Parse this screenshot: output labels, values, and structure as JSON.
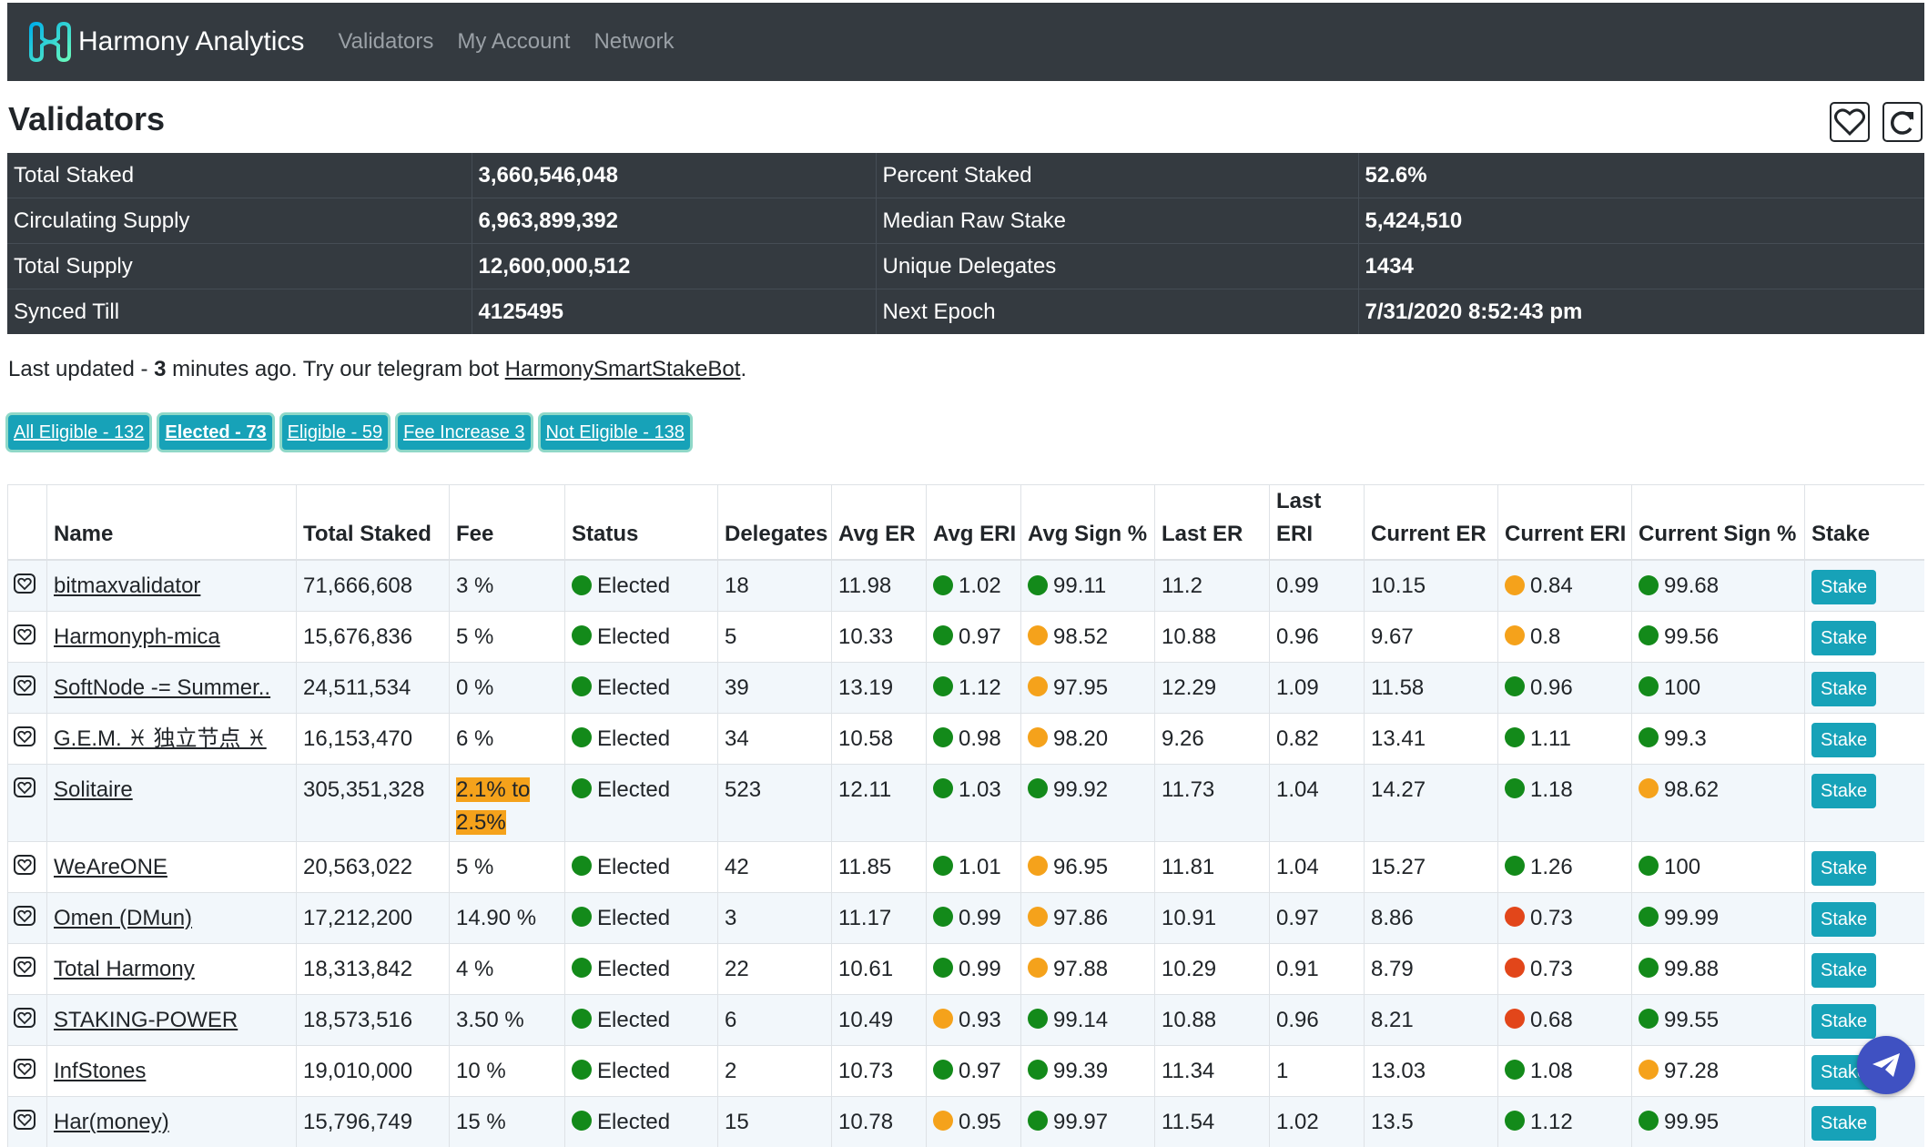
{
  "nav": {
    "brand": "Harmony Analytics",
    "links": [
      "Validators",
      "My Account",
      "Network"
    ]
  },
  "page": {
    "title": "Validators",
    "favorite_icon": "heart-icon",
    "refresh_icon": "refresh-icon"
  },
  "stats": [
    [
      "Total Staked",
      "3,660,546,048",
      "Percent Staked",
      "52.6%"
    ],
    [
      "Circulating Supply",
      "6,963,899,392",
      "Median Raw Stake",
      "5,424,510"
    ],
    [
      "Total Supply",
      "12,600,000,512",
      "Unique Delegates",
      "1434"
    ],
    [
      "Synced Till",
      "4125495",
      "Next Epoch",
      "7/31/2020 8:52:43 pm"
    ]
  ],
  "updated": {
    "prefix": "Last updated - ",
    "minutes": "3",
    "middle": " minutes ago. Try our telegram bot ",
    "bot_link": "HarmonySmartStakeBot",
    "suffix": "."
  },
  "filters": [
    {
      "label": "All Eligible - 132",
      "active": false
    },
    {
      "label": "Elected - 73",
      "active": true
    },
    {
      "label": "Eligible - 59",
      "active": false
    },
    {
      "label": "Fee Increase 3",
      "active": false
    },
    {
      "label": "Not Eligible - 138",
      "active": false
    }
  ],
  "columns": [
    "",
    "Name",
    "Total Staked",
    "Fee",
    "Status",
    "Delegates",
    "Avg ER",
    "Avg ERI",
    "Avg Sign %",
    "Last ER",
    "Last ERI",
    "Current ER",
    "Current ERI",
    "Current Sign %",
    "Stake"
  ],
  "colors": {
    "green": "#138a1a",
    "orange": "#f5a21b",
    "red": "#e2461a",
    "accent": "#17a2b8",
    "navbar": "#343a40"
  },
  "rows": [
    {
      "name": "bitmaxvalidator",
      "staked": "71,666,608",
      "fee": "3 %",
      "status": "Elected",
      "delegates": "18",
      "avg_er": "11.98",
      "avg_eri": [
        "green",
        "1.02"
      ],
      "avg_sign": [
        "green",
        "99.11"
      ],
      "last_er": "11.2",
      "last_eri": "0.99",
      "cur_er": "10.15",
      "cur_eri": [
        "orange",
        "0.84"
      ],
      "cur_sign": [
        "green",
        "99.68"
      ],
      "stake": "Stake"
    },
    {
      "name": "Harmonyph-mica",
      "staked": "15,676,836",
      "fee": "5 %",
      "status": "Elected",
      "delegates": "5",
      "avg_er": "10.33",
      "avg_eri": [
        "green",
        "0.97"
      ],
      "avg_sign": [
        "orange",
        "98.52"
      ],
      "last_er": "10.88",
      "last_eri": "0.96",
      "cur_er": "9.67",
      "cur_eri": [
        "orange",
        "0.8"
      ],
      "cur_sign": [
        "green",
        "99.56"
      ],
      "stake": "Stake"
    },
    {
      "name": "SoftNode -= Summer..",
      "staked": "24,511,534",
      "fee": "0 %",
      "status": "Elected",
      "delegates": "39",
      "avg_er": "13.19",
      "avg_eri": [
        "green",
        "1.12"
      ],
      "avg_sign": [
        "orange",
        "97.95"
      ],
      "last_er": "12.29",
      "last_eri": "1.09",
      "cur_er": "11.58",
      "cur_eri": [
        "green",
        "0.96"
      ],
      "cur_sign": [
        "green",
        "100"
      ],
      "stake": "Stake"
    },
    {
      "name": "G.E.M. ♓ 独立节点 ♓",
      "staked": "16,153,470",
      "fee": "6 %",
      "status": "Elected",
      "delegates": "34",
      "avg_er": "10.58",
      "avg_eri": [
        "green",
        "0.98"
      ],
      "avg_sign": [
        "orange",
        "98.20"
      ],
      "last_er": "9.26",
      "last_eri": "0.82",
      "cur_er": "13.41",
      "cur_eri": [
        "green",
        "1.11"
      ],
      "cur_sign": [
        "green",
        "99.3"
      ],
      "stake": "Stake"
    },
    {
      "name": "Solitaire",
      "staked": "305,351,328",
      "fee": "2.1% to 2.5%",
      "fee_highlight": true,
      "status": "Elected",
      "delegates": "523",
      "avg_er": "12.11",
      "avg_eri": [
        "green",
        "1.03"
      ],
      "avg_sign": [
        "green",
        "99.92"
      ],
      "last_er": "11.73",
      "last_eri": "1.04",
      "cur_er": "14.27",
      "cur_eri": [
        "green",
        "1.18"
      ],
      "cur_sign": [
        "orange",
        "98.62"
      ],
      "stake": "Stake"
    },
    {
      "name": "WeAreONE",
      "staked": "20,563,022",
      "fee": "5 %",
      "status": "Elected",
      "delegates": "42",
      "avg_er": "11.85",
      "avg_eri": [
        "green",
        "1.01"
      ],
      "avg_sign": [
        "orange",
        "96.95"
      ],
      "last_er": "11.81",
      "last_eri": "1.04",
      "cur_er": "15.27",
      "cur_eri": [
        "green",
        "1.26"
      ],
      "cur_sign": [
        "green",
        "100"
      ],
      "stake": "Stake"
    },
    {
      "name": "Omen (DMun)",
      "staked": "17,212,200",
      "fee": "14.90 %",
      "status": "Elected",
      "delegates": "3",
      "avg_er": "11.17",
      "avg_eri": [
        "green",
        "0.99"
      ],
      "avg_sign": [
        "orange",
        "97.86"
      ],
      "last_er": "10.91",
      "last_eri": "0.97",
      "cur_er": "8.86",
      "cur_eri": [
        "red",
        "0.73"
      ],
      "cur_sign": [
        "green",
        "99.99"
      ],
      "stake": "Stake"
    },
    {
      "name": "Total Harmony",
      "staked": "18,313,842",
      "fee": "4 %",
      "status": "Elected",
      "delegates": "22",
      "avg_er": "10.61",
      "avg_eri": [
        "green",
        "0.99"
      ],
      "avg_sign": [
        "orange",
        "97.88"
      ],
      "last_er": "10.29",
      "last_eri": "0.91",
      "cur_er": "8.79",
      "cur_eri": [
        "red",
        "0.73"
      ],
      "cur_sign": [
        "green",
        "99.88"
      ],
      "stake": "Stake"
    },
    {
      "name": "STAKING-POWER",
      "staked": "18,573,516",
      "fee": "3.50 %",
      "status": "Elected",
      "delegates": "6",
      "avg_er": "10.49",
      "avg_eri": [
        "orange",
        "0.93"
      ],
      "avg_sign": [
        "green",
        "99.14"
      ],
      "last_er": "10.88",
      "last_eri": "0.96",
      "cur_er": "8.21",
      "cur_eri": [
        "red",
        "0.68"
      ],
      "cur_sign": [
        "green",
        "99.55"
      ],
      "stake": "Stake"
    },
    {
      "name": "InfStones",
      "staked": "19,010,000",
      "fee": "10 %",
      "status": "Elected",
      "delegates": "2",
      "avg_er": "10.73",
      "avg_eri": [
        "green",
        "0.97"
      ],
      "avg_sign": [
        "green",
        "99.39"
      ],
      "last_er": "11.34",
      "last_eri": "1",
      "cur_er": "13.03",
      "cur_eri": [
        "green",
        "1.08"
      ],
      "cur_sign": [
        "orange",
        "97.28"
      ],
      "stake": "Stake"
    },
    {
      "name": "Har(money)",
      "staked": "15,796,749",
      "fee": "15 %",
      "status": "Elected",
      "delegates": "15",
      "avg_er": "10.78",
      "avg_eri": [
        "orange",
        "0.95"
      ],
      "avg_sign": [
        "green",
        "99.97"
      ],
      "last_er": "11.54",
      "last_eri": "1.02",
      "cur_er": "13.5",
      "cur_eri": [
        "green",
        "1.12"
      ],
      "cur_sign": [
        "green",
        "99.95"
      ],
      "stake": "Stake"
    }
  ],
  "telegram_fab_icon": "telegram-send-icon"
}
